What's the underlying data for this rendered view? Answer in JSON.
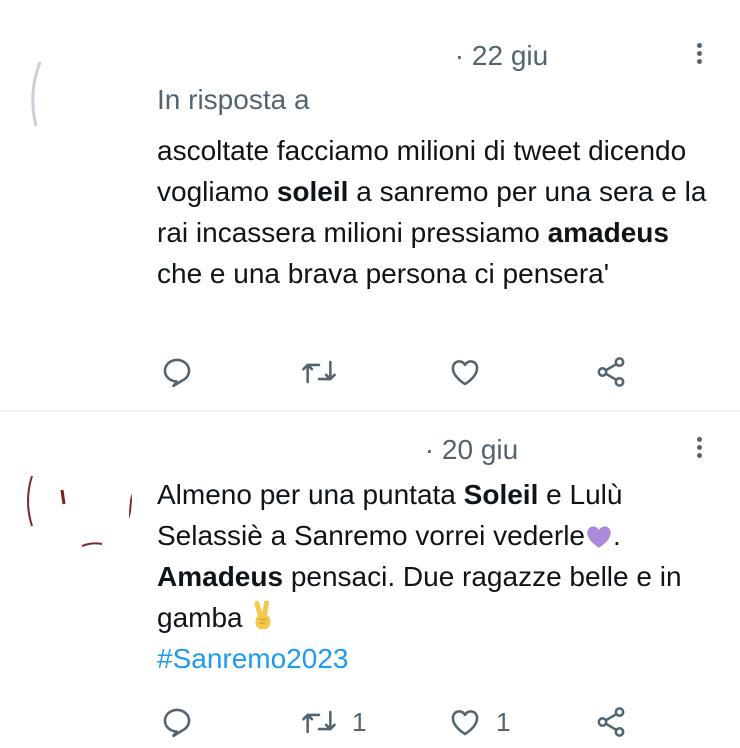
{
  "colors": {
    "text": "#0f1419",
    "muted": "#536471",
    "link": "#1d9bf0",
    "divider": "#eff3f4"
  },
  "tweets": [
    {
      "separator": "·",
      "date": "22 giu",
      "reply_prefix": "In risposta a",
      "body": {
        "t1": "ascoltate facciamo milioni di tweet dicendo vogliamo ",
        "b1": "soleil",
        "t2": " a sanremo per una sera e la rai incassera milioni pressiamo ",
        "b2": "amadeus",
        "t3": " che e una brava persona ci pensera'"
      },
      "actions": {
        "reply_icon": "reply-icon",
        "retweet_icon": "retweet-icon",
        "like_icon": "heart-icon",
        "share_icon": "share-icon"
      }
    },
    {
      "separator": "·",
      "date": "20 giu",
      "body": {
        "t1": "Almeno per una puntata ",
        "b1": "Soleil",
        "t2": " e Lulù Selassiè a Sanremo vorrei vederle",
        "emoji1": "purple-heart",
        "t3": ". ",
        "b2": "Amadeus",
        "t4": " pensaci. Due ragazze belle e in gamba ",
        "emoji2": "victory-hand",
        "hashtag": "#Sanremo2023"
      },
      "actions": {
        "retweet_count": "1",
        "like_count": "1"
      }
    }
  ]
}
